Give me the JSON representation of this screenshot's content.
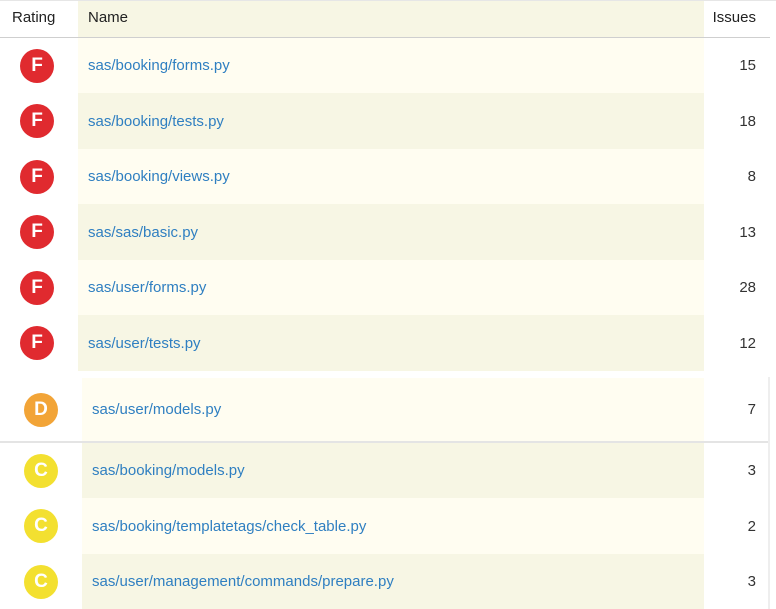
{
  "table": {
    "headers": {
      "rating": "Rating",
      "name": "Name",
      "issues": "Issues"
    },
    "rows": [
      {
        "grade": "F",
        "color": "#e02a2f",
        "file": "sas/booking/forms.py",
        "issues": "15"
      },
      {
        "grade": "F",
        "color": "#e02a2f",
        "file": "sas/booking/tests.py",
        "issues": "18"
      },
      {
        "grade": "F",
        "color": "#e02a2f",
        "file": "sas/booking/views.py",
        "issues": "8"
      },
      {
        "grade": "F",
        "color": "#e02a2f",
        "file": "sas/sas/basic.py",
        "issues": "13"
      },
      {
        "grade": "F",
        "color": "#e02a2f",
        "file": "sas/user/forms.py",
        "issues": "28"
      },
      {
        "grade": "F",
        "color": "#e02a2f",
        "file": "sas/user/tests.py",
        "issues": "12"
      },
      {
        "grade": "D",
        "color": "#f2a437",
        "file": "sas/user/models.py",
        "issues": "7"
      },
      {
        "grade": "C",
        "color": "#f3e030",
        "file": "sas/booking/models.py",
        "issues": "3"
      },
      {
        "grade": "C",
        "color": "#f3e030",
        "file": "sas/booking/templatetags/check_table.py",
        "issues": "2"
      },
      {
        "grade": "C",
        "color": "#f3e030",
        "file": "sas/user/management/commands/prepare.py",
        "issues": "3"
      }
    ]
  },
  "colors": {
    "link": "#2f7fc1",
    "row_light": "#fffdf1",
    "row_dark": "#f7f6e4"
  }
}
